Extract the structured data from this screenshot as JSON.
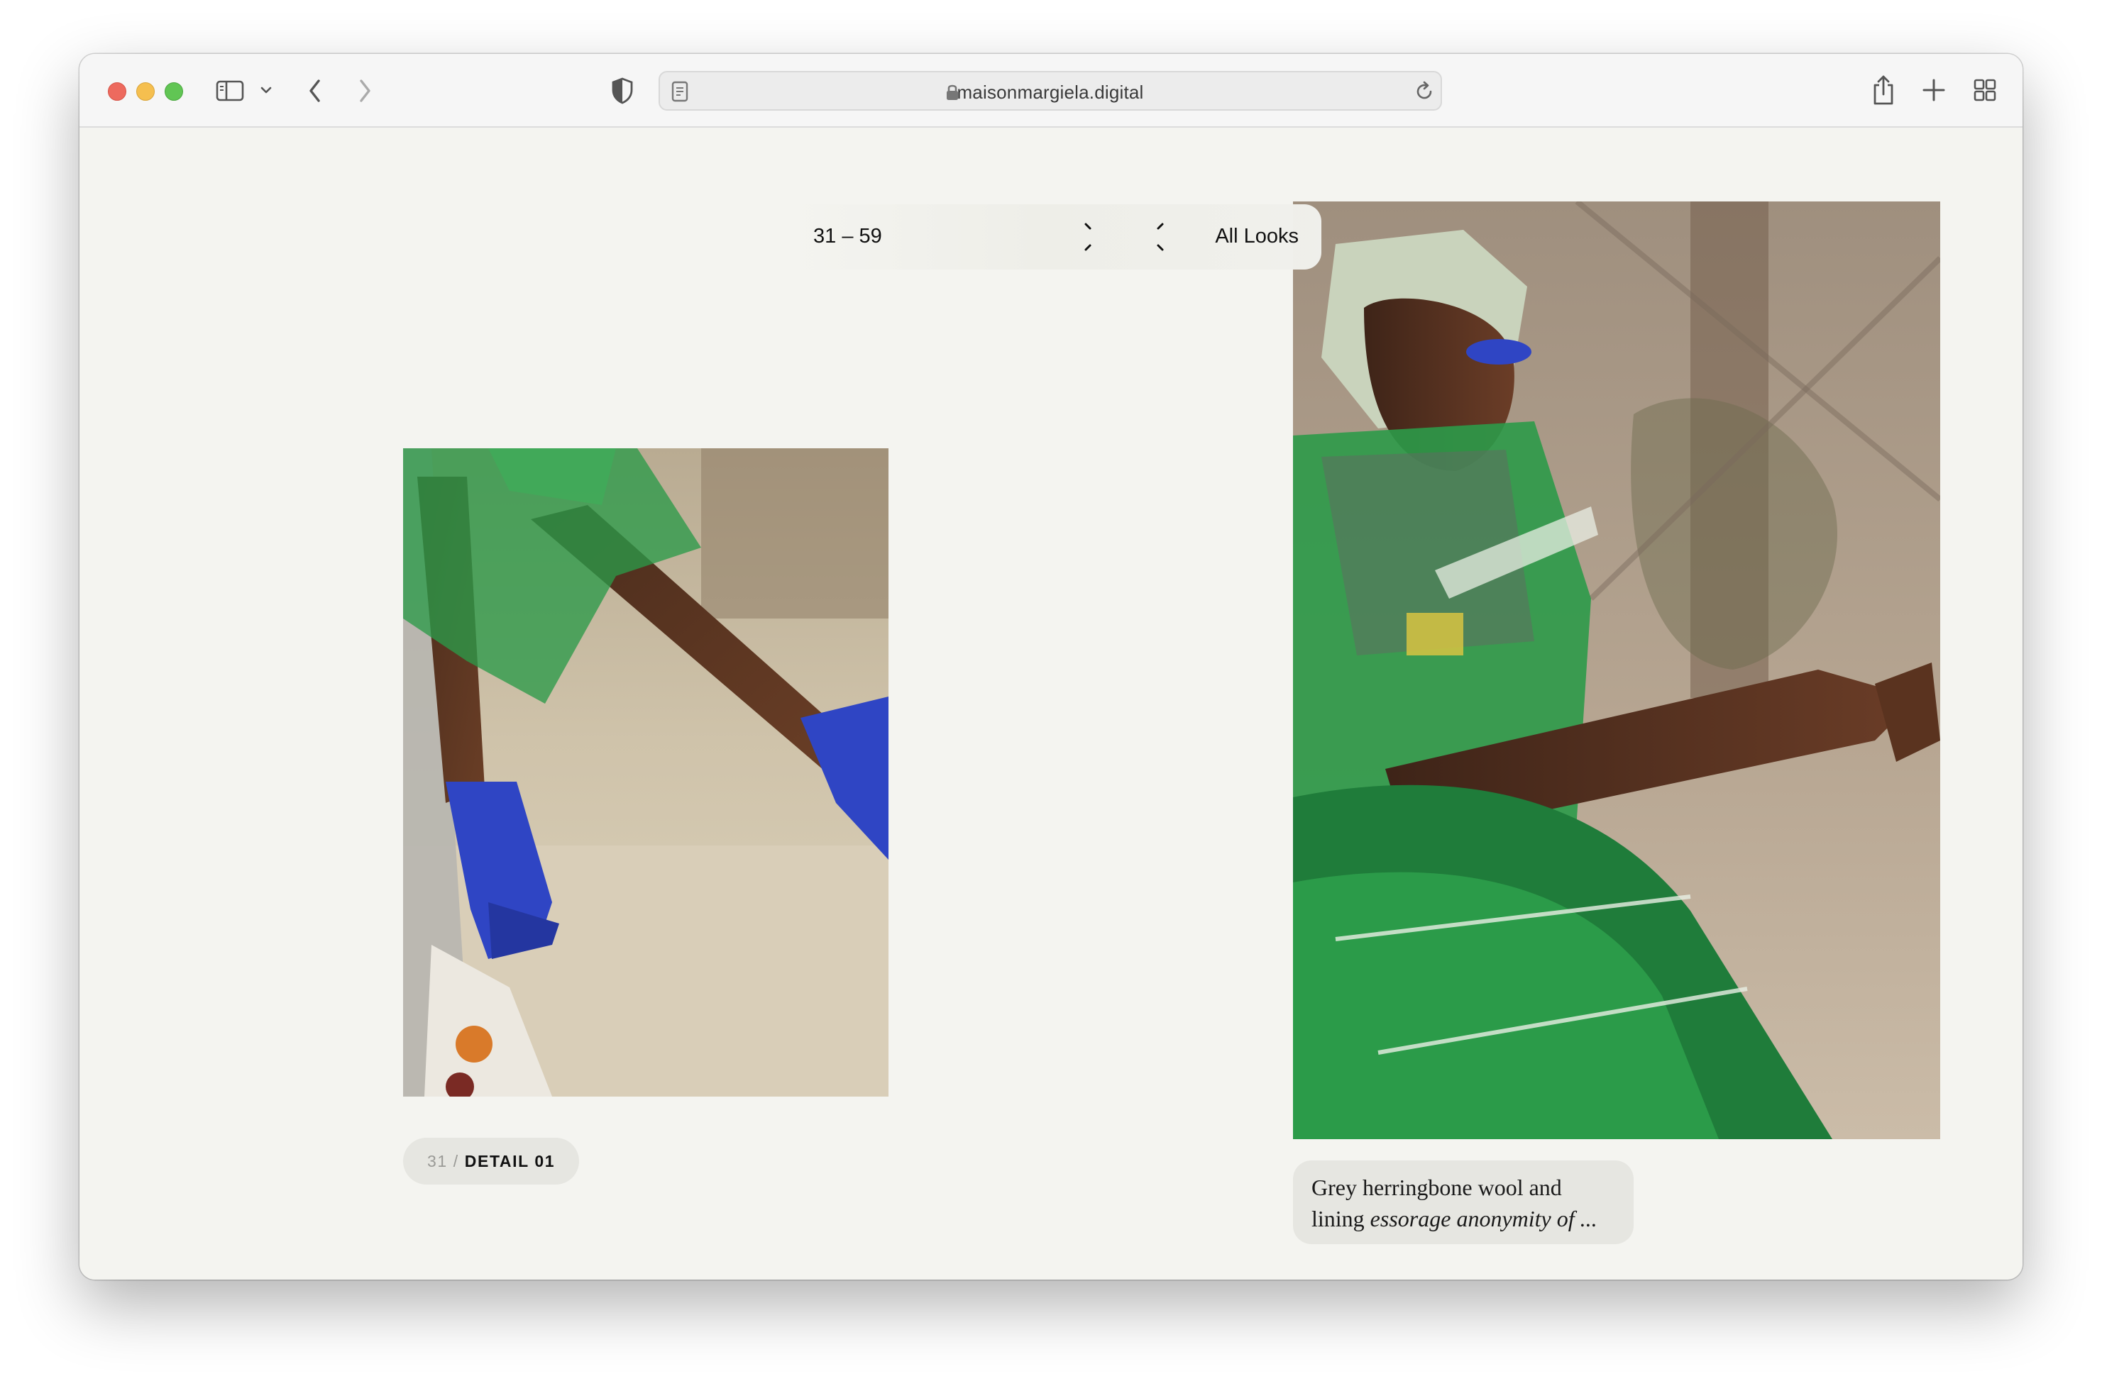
{
  "browser": {
    "url": "maisonmargiela.digital",
    "icons": {
      "sidebar": "sidebar-icon",
      "chevron": "chevron-down-icon",
      "back": "back-icon",
      "forward": "forward-icon",
      "shield": "shield-icon",
      "reader": "reader-icon",
      "lock": "lock-icon",
      "reload": "reload-icon",
      "share": "share-icon",
      "new_tab": "plus-icon",
      "tabs": "tab-overview-icon"
    }
  },
  "pager": {
    "range": "31 – 59",
    "all_looks": "All Looks"
  },
  "looks": {
    "left": {
      "number": "31",
      "separator": "/",
      "label": "DETAIL 01",
      "image": "Close-up of legs in blue heeled boots and green tulle"
    },
    "right": {
      "caption_line1": "Grey herringbone wool and",
      "caption_line2_prefix": "lining ",
      "caption_line2_italic": "essorage anonymity of ...",
      "image": "Model in green tulle and grey herringbone outfit"
    }
  },
  "colors": {
    "page_bg": "#f4f4f0",
    "caption_bg": "#e6e6e1",
    "boot_blue": "#2f45c4",
    "tulle_green": "#2c9a49"
  }
}
